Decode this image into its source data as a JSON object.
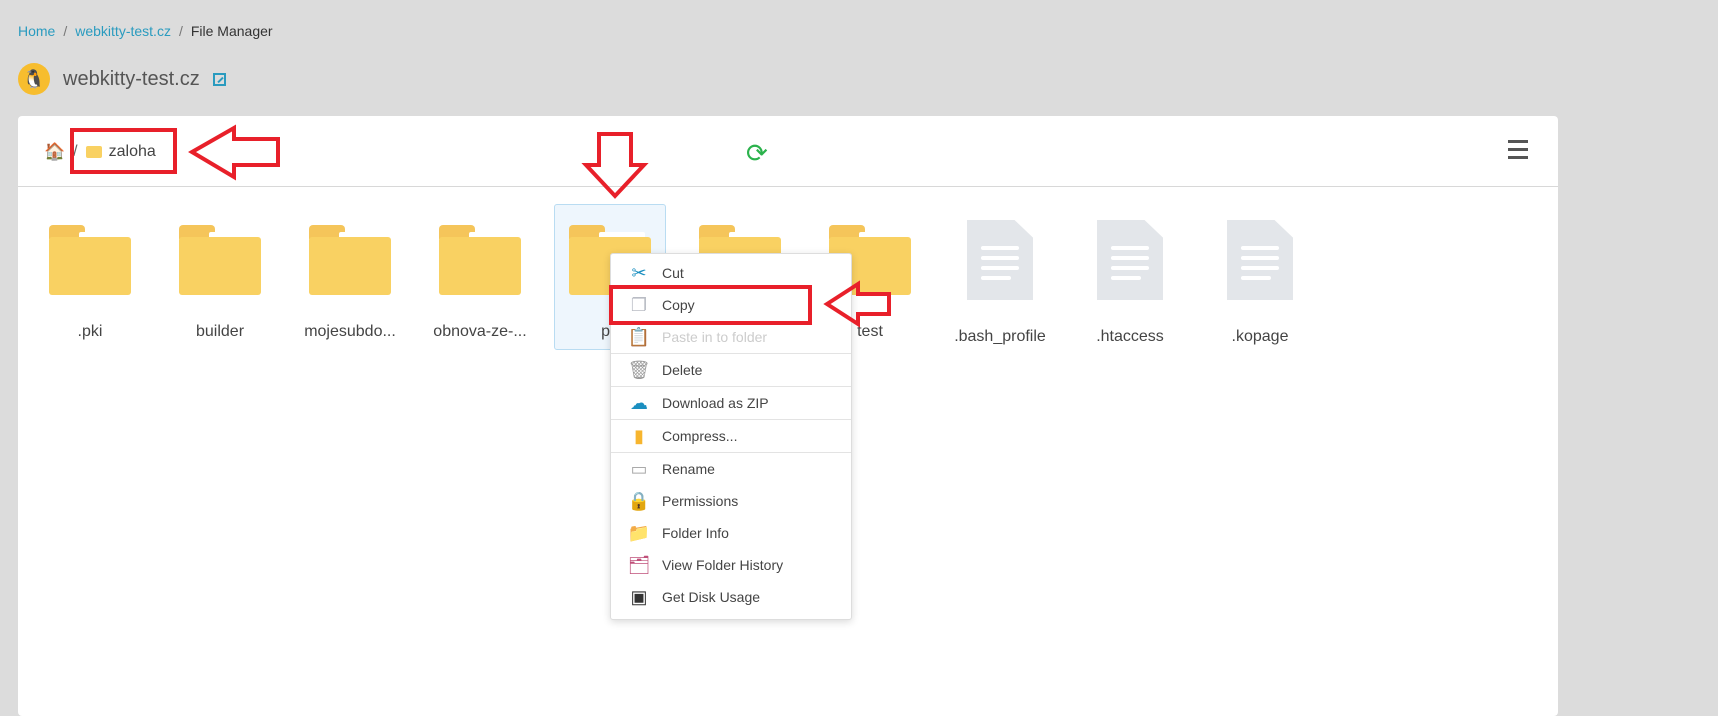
{
  "breadcrumb": [
    {
      "label": "Home",
      "link": true
    },
    {
      "label": "webkitty-test.cz",
      "link": true
    },
    {
      "label": "File Manager",
      "link": false
    }
  ],
  "site": {
    "name": "webkitty-test.cz",
    "avatar_icon": "linux-penguin-icon"
  },
  "toolbar": {
    "current_folder": "zaloha",
    "path_separator": "/"
  },
  "files": [
    {
      "name": ".pki",
      "type": "folder"
    },
    {
      "name": "builder",
      "type": "folder"
    },
    {
      "name": "mojesubdo...",
      "type": "folder"
    },
    {
      "name": "obnova-ze-...",
      "type": "folder"
    },
    {
      "name": "po",
      "type": "folder",
      "selected": true
    },
    {
      "name": "",
      "type": "folder"
    },
    {
      "name": "test",
      "type": "folder"
    },
    {
      "name": ".bash_profile",
      "type": "file"
    },
    {
      "name": ".htaccess",
      "type": "file"
    },
    {
      "name": ".kopage",
      "type": "file"
    }
  ],
  "context_menu": [
    {
      "label": "Cut",
      "icon": "scissors-icon",
      "glyph": "✂",
      "color": "#1b8fc0"
    },
    {
      "label": "Copy",
      "icon": "copy-icon",
      "glyph": "❐",
      "color": "#b9bcc4"
    },
    {
      "label": "Paste in to folder",
      "icon": "clipboard-icon",
      "glyph": "📋",
      "color": "#f4d8b0",
      "disabled": true,
      "divider_after": true
    },
    {
      "label": "Delete",
      "icon": "trash-icon",
      "glyph": "🗑",
      "color": "#999",
      "divider_after": true
    },
    {
      "label": "Download as ZIP",
      "icon": "cloud-download-icon",
      "glyph": "☁",
      "color": "#1b8fc0",
      "divider_after": true
    },
    {
      "label": "Compress...",
      "icon": "zip-file-icon",
      "glyph": "▮",
      "color": "#f7b52e",
      "divider_after": true
    },
    {
      "label": "Rename",
      "icon": "rename-icon",
      "glyph": "▭",
      "color": "#aaa"
    },
    {
      "label": "Permissions",
      "icon": "lock-icon",
      "glyph": "🔒",
      "color": "#1b8fc0"
    },
    {
      "label": "Folder Info",
      "icon": "folder-info-icon",
      "glyph": "📁",
      "color": "#f9d162"
    },
    {
      "label": "View Folder History",
      "icon": "folder-history-icon",
      "glyph": "🗂",
      "color": "#c0507a"
    },
    {
      "label": "Get Disk Usage",
      "icon": "disk-usage-icon",
      "glyph": "▣",
      "color": "#333"
    }
  ],
  "annotation_color": "#e8202a"
}
